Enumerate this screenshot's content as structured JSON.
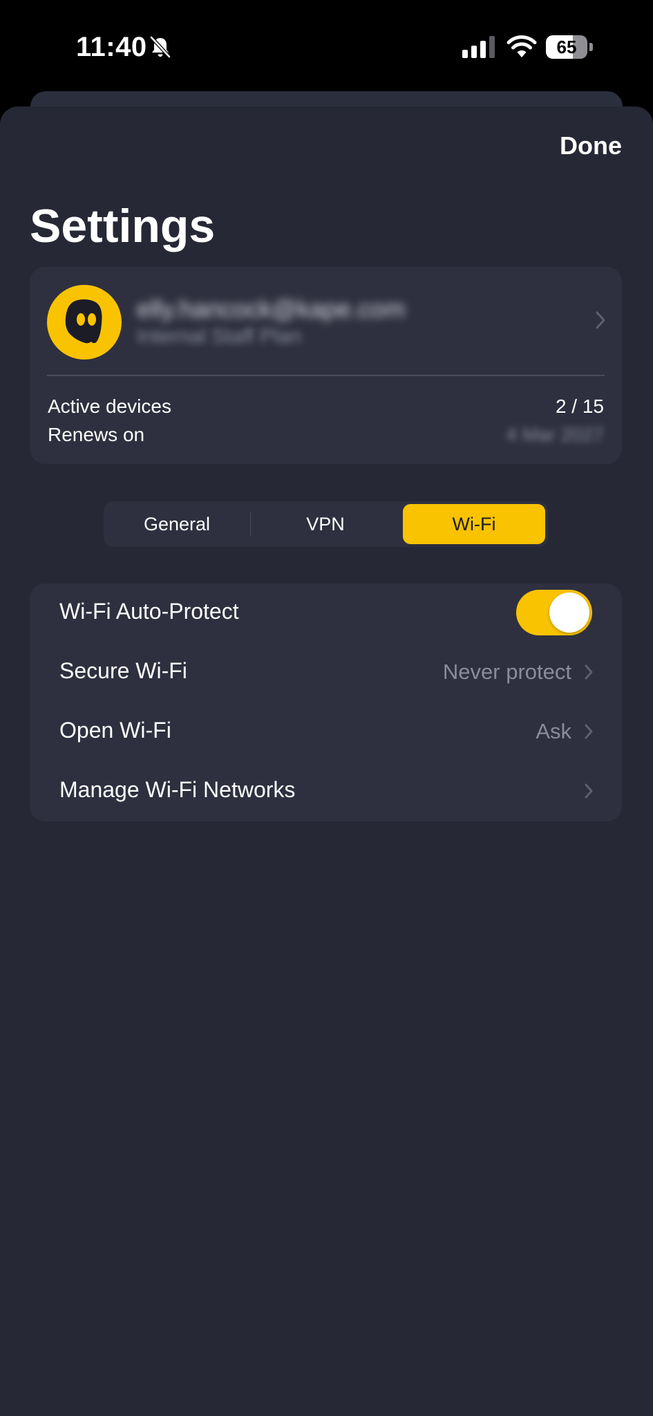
{
  "status_bar": {
    "time": "11:40",
    "battery": "65",
    "battery_level": 0.65
  },
  "header": {
    "done_label": "Done",
    "title": "Settings"
  },
  "account": {
    "email": "elly.hancock@kape.com",
    "plan": "Internal Staff Plan",
    "active_devices_label": "Active devices",
    "active_devices_value": "2 / 15",
    "renews_label": "Renews on",
    "renews_value": "4 Mar 2027"
  },
  "tabs": [
    {
      "label": "General",
      "active": false
    },
    {
      "label": "VPN",
      "active": false
    },
    {
      "label": "Wi-Fi",
      "active": true
    }
  ],
  "wifi_settings": {
    "auto_protect_label": "Wi-Fi Auto-Protect",
    "auto_protect_on": true,
    "secure_wifi_label": "Secure Wi-Fi",
    "secure_wifi_value": "Never protect",
    "open_wifi_label": "Open Wi-Fi",
    "open_wifi_value": "Ask",
    "manage_label": "Manage Wi-Fi Networks"
  },
  "colors": {
    "accent": "#f9c301",
    "background": "#262835",
    "card": "#2e303f"
  },
  "icons": {
    "bell": "bell-slash-icon",
    "signal": "cellular-signal-icon",
    "wifi": "wifi-icon",
    "avatar": "ghost-icon",
    "chevron": "chevron-right-icon"
  }
}
